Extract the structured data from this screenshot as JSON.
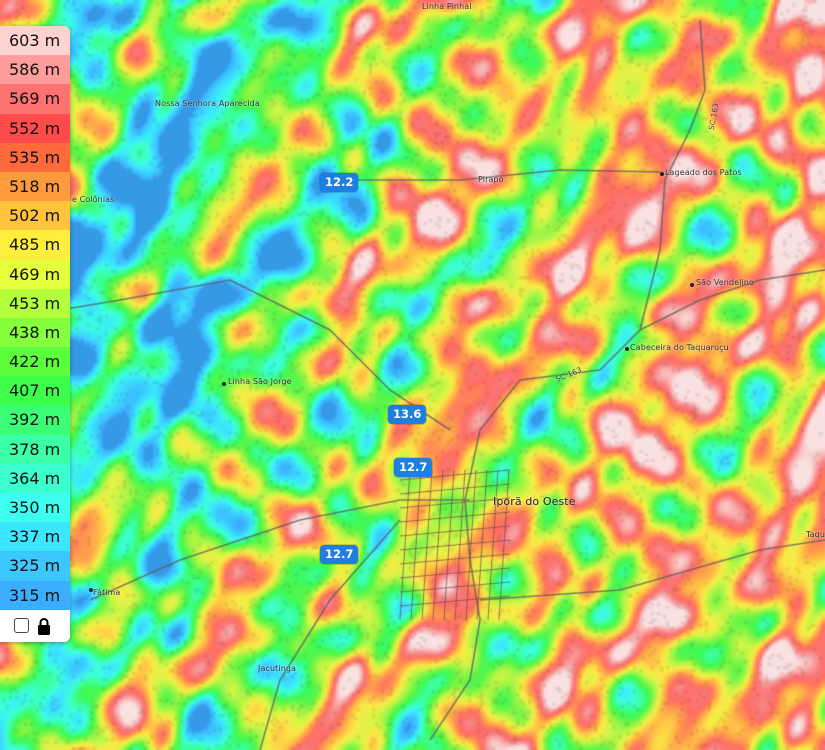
{
  "legend": {
    "items": [
      {
        "label": "603 m",
        "color": "#ffd2d2"
      },
      {
        "label": "586 m",
        "color": "#ff9d9d"
      },
      {
        "label": "569 m",
        "color": "#ff7272"
      },
      {
        "label": "552 m",
        "color": "#ff4b4b"
      },
      {
        "label": "535 m",
        "color": "#ff6a3c"
      },
      {
        "label": "518 m",
        "color": "#ff9b3c"
      },
      {
        "label": "502 m",
        "color": "#ffc43c"
      },
      {
        "label": "485 m",
        "color": "#ffee3c"
      },
      {
        "label": "469 m",
        "color": "#e4ff3c"
      },
      {
        "label": "453 m",
        "color": "#b4ff3c"
      },
      {
        "label": "438 m",
        "color": "#86ff3c"
      },
      {
        "label": "422 m",
        "color": "#5cff3c"
      },
      {
        "label": "407 m",
        "color": "#3cff4a"
      },
      {
        "label": "392 m",
        "color": "#3cff78"
      },
      {
        "label": "378 m",
        "color": "#3cffa6"
      },
      {
        "label": "364 m",
        "color": "#3cffd0"
      },
      {
        "label": "350 m",
        "color": "#3cfff0"
      },
      {
        "label": "337 m",
        "color": "#3ce6ff"
      },
      {
        "label": "325 m",
        "color": "#3cc8ff"
      },
      {
        "label": "315 m",
        "color": "#3caeff"
      }
    ]
  },
  "places": {
    "linha_pinhal": "Linha Pinhal",
    "nossa_senhora": "Nossa Senhora Aparecida",
    "colonias": "e Colônias",
    "pirapo": "Pirapó",
    "lageado_patos": "Lageado dos Patos",
    "sao_vendelino": "São Vendelino",
    "cabeceira": "Cabeceira do Taquaruçu",
    "linha_sao_jorge": "Linha São Jorge",
    "ipora": "Iporã do Oeste",
    "fatima": "Fátima",
    "jacutinga": "Jacutinga",
    "taqua": "Taqua",
    "road_sc163_a": "SC 163",
    "road_sc163_b": "SC 163"
  },
  "markers": {
    "m1": "12.2",
    "m2": "13.6",
    "m3": "12.7",
    "m4": "12.7"
  }
}
